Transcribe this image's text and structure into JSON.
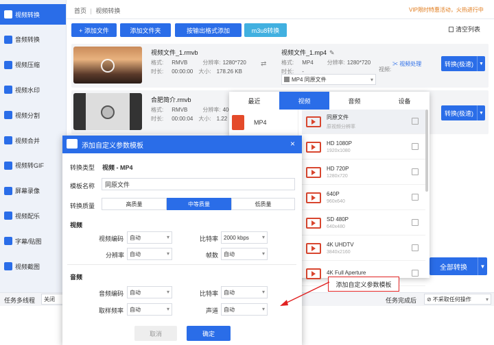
{
  "colors": {
    "accent": "#2a6de8",
    "red": "#e02020",
    "vip": "#e07a1a"
  },
  "sidebar": {
    "items": [
      {
        "label": "视频转换",
        "icon": "convert-icon",
        "active": true
      },
      {
        "label": "音频转换",
        "icon": "audio-icon"
      },
      {
        "label": "视频压缩",
        "icon": "compress-icon"
      },
      {
        "label": "视频水印",
        "icon": "watermark-icon"
      },
      {
        "label": "视频分割",
        "icon": "split-icon"
      },
      {
        "label": "视频合并",
        "icon": "merge-icon"
      },
      {
        "label": "视频转GIF",
        "icon": "gif-icon"
      },
      {
        "label": "屏幕录像",
        "icon": "record-icon"
      },
      {
        "label": "视频配乐",
        "icon": "music-icon"
      },
      {
        "label": "字幕/贴图",
        "icon": "subtitle-icon"
      },
      {
        "label": "视频截图",
        "icon": "screenshot-icon"
      }
    ]
  },
  "breadcrumb": {
    "home": "首页",
    "sep": "|",
    "current": "视频转换"
  },
  "vip": "VIP限时特惠活动，火热进行中",
  "toolbar": {
    "add_file": "+ 添加文件",
    "add_folder": "添加文件夹",
    "batch_add": "按输出格式添加",
    "m3u8": "m3u8转换",
    "clear": "清空列表"
  },
  "files": [
    {
      "name": "视频文件_1.rmvb",
      "fmt_lbl": "格式:",
      "fmt": "RMVB",
      "res_lbl": "分辨率:",
      "res": "1280*720",
      "dur_lbl": "时长:",
      "dur": "00:00:00",
      "size_lbl": "大小:",
      "size": "178.26 KB",
      "out_name": "视频文件_1.mp4",
      "out_fmt": "MP4",
      "out_res": "1280*720",
      "out_dur": "-",
      "video_lbl": "视频:",
      "preset": "MP4 同原文件",
      "process": "视频处理",
      "convert": "转换(极速)"
    },
    {
      "name": "合肥简介.rmvb",
      "fmt": "RMVB",
      "res": "400*",
      "dur": "00:00:04",
      "size": "1.22",
      "convert": "转换(极速)"
    }
  ],
  "format_panel": {
    "tabs": [
      "最近",
      "视频",
      "音频",
      "设备"
    ],
    "active_tab": 1,
    "category": "MP4",
    "presets": [
      {
        "name": "同原文件",
        "sub": "原视频分辨率"
      },
      {
        "name": "HD 1080P",
        "sub": "1920x1080"
      },
      {
        "name": "HD 720P",
        "sub": "1280x720"
      },
      {
        "name": "640P",
        "sub": "960x640"
      },
      {
        "name": "SD 480P",
        "sub": "640x480"
      },
      {
        "name": "4K UHDTV",
        "sub": "3840x2160"
      },
      {
        "name": "4K Full Aperture",
        "sub": ""
      }
    ],
    "add_template": "添加自定义参数模板"
  },
  "dialog": {
    "title": "添加自定义参数模板",
    "type_lbl": "转换类型",
    "type_val": "视频 - MP4",
    "name_lbl": "模板名称",
    "name_val": "同原文件",
    "quality_lbl": "转换质量",
    "quality": [
      "高质量",
      "中等质量",
      "低质量"
    ],
    "quality_active": 1,
    "video_sec": "视频",
    "v_codec_lbl": "视频编码",
    "v_codec": "自动",
    "bitrate_lbl": "比特率",
    "bitrate": "2000 kbps",
    "res_lbl": "分辨率",
    "res": "自动",
    "fps_lbl": "帧数",
    "fps": "自动",
    "audio_sec": "音频",
    "a_codec_lbl": "音频编码",
    "a_codec": "自动",
    "a_bitrate_lbl": "比特率",
    "a_bitrate": "自动",
    "sample_lbl": "取样频率",
    "sample": "自动",
    "channel_lbl": "声道",
    "channel": "自动",
    "cancel": "取消",
    "ok": "确定"
  },
  "bottom": {
    "multi_task": "任务多线程",
    "multi_val": "关闭",
    "after": "任务完成后",
    "after_val": "不采取任何操作",
    "all_convert": "全部转换"
  }
}
